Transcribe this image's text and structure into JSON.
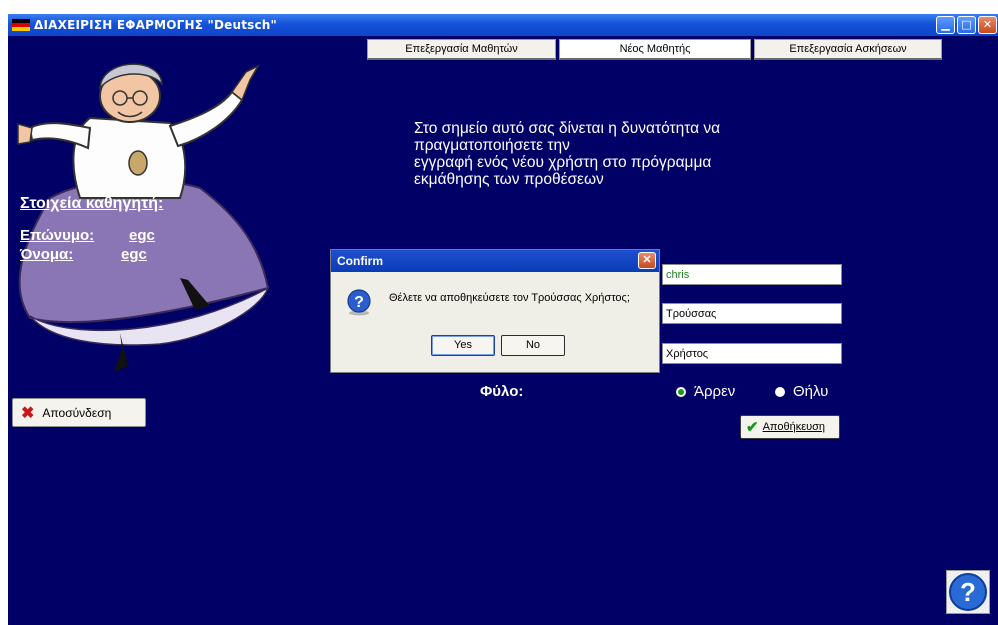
{
  "window": {
    "title": "ΔΙΑΧΕΙΡΙΣΗ ΕΦΑΡΜΟΓΗΣ \"Deutsch\"",
    "flag_colors": [
      "#000000",
      "#dd0000",
      "#ffcc00"
    ],
    "controls": [
      "minimize-icon",
      "maximize-icon",
      "close-icon"
    ]
  },
  "tabs": [
    {
      "label": "Επεξεργασία Μαθητών"
    },
    {
      "label": "Νέος Μαθητής"
    },
    {
      "label": "Επεξεργασία Ασκήσεων"
    }
  ],
  "intro": {
    "line1": "Στο σημείο αυτό σας δίνεται η δυνατότητα να",
    "line2": "πραγματοποιήσετε την",
    "line3": "εγγραφή ενός νέου χρήστη στο πρόγραμμα",
    "line4": "εκμάθησης των προθέσεων"
  },
  "teacher": {
    "title": "Στοιχεία καθηγητή:",
    "surname_label": "Επώνυμο:",
    "surname_value": "egc",
    "name_label": "Όνομα:",
    "name_value": "egc"
  },
  "logout": {
    "label": "Αποσύνδεση",
    "icon": "x-icon"
  },
  "form": {
    "username": "chris",
    "surname": "Τρούσσας",
    "name": "Χρήστος",
    "gender_label": "Φύλο:",
    "gender_male": "Άρρεν",
    "gender_female": "Θήλυ",
    "gender_selected": "male",
    "save_label": "Αποθήκευση"
  },
  "dialog": {
    "title": "Confirm",
    "message": "Θέλετε να αποθηκεύσετε τον Τρούσσας Χρήστος;",
    "yes_label": "Yes",
    "no_label": "No",
    "icon": "question-icon"
  },
  "colors": {
    "background": "#000066",
    "titlebar": "#1552d8"
  }
}
